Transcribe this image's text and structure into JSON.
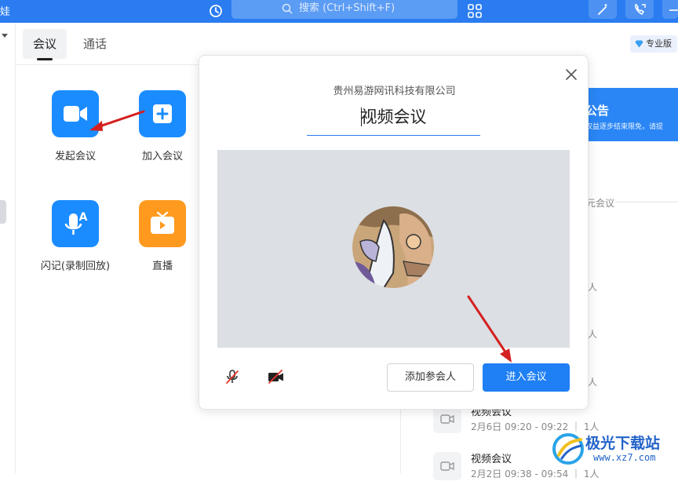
{
  "topbar": {
    "edge_text": "娃",
    "search_placeholder": "搜索 (Ctrl+Shift+F)"
  },
  "tabs": [
    {
      "label": "会议",
      "active": true
    },
    {
      "label": "通话",
      "active": false
    }
  ],
  "apps": [
    {
      "label": "发起会议",
      "icon": "video-camera-icon"
    },
    {
      "label": "加入会议",
      "icon": "plus-icon"
    },
    {
      "label": "闪记(录制回放)",
      "icon": "voice-note-icon"
    },
    {
      "label": "直播",
      "icon": "tv-icon"
    }
  ],
  "right_panel": {
    "pro_badge": "专业版",
    "banner_title": "公告",
    "banner_text": "权益逐步结束限免，请提",
    "fragment_meeting": "元会议",
    "fragment_people": "人",
    "fragment_x1": "人",
    "fragment_x2": "人",
    "recent": [
      {
        "title": "视频会议",
        "detail": "2月6日 09:20 - 09:22 ｜ 1人"
      },
      {
        "title": "视频会议",
        "detail": "2月2日 09:38 - 09:54 ｜ 1人"
      }
    ]
  },
  "dialog": {
    "company": "贵州易游网讯科技有限公司",
    "meeting_title": "视频会议",
    "add_participants": "添加参会人",
    "enter_meeting": "进入会议"
  },
  "watermark": {
    "name": "极光下载站",
    "url": "www.xz7.com"
  },
  "colors": {
    "brand_blue": "#2a7cf0",
    "button_blue": "#1f7ff5",
    "tile_blue": "#1a8cff",
    "tile_orange": "#ff9a1f",
    "annotation_red": "#d42020"
  }
}
